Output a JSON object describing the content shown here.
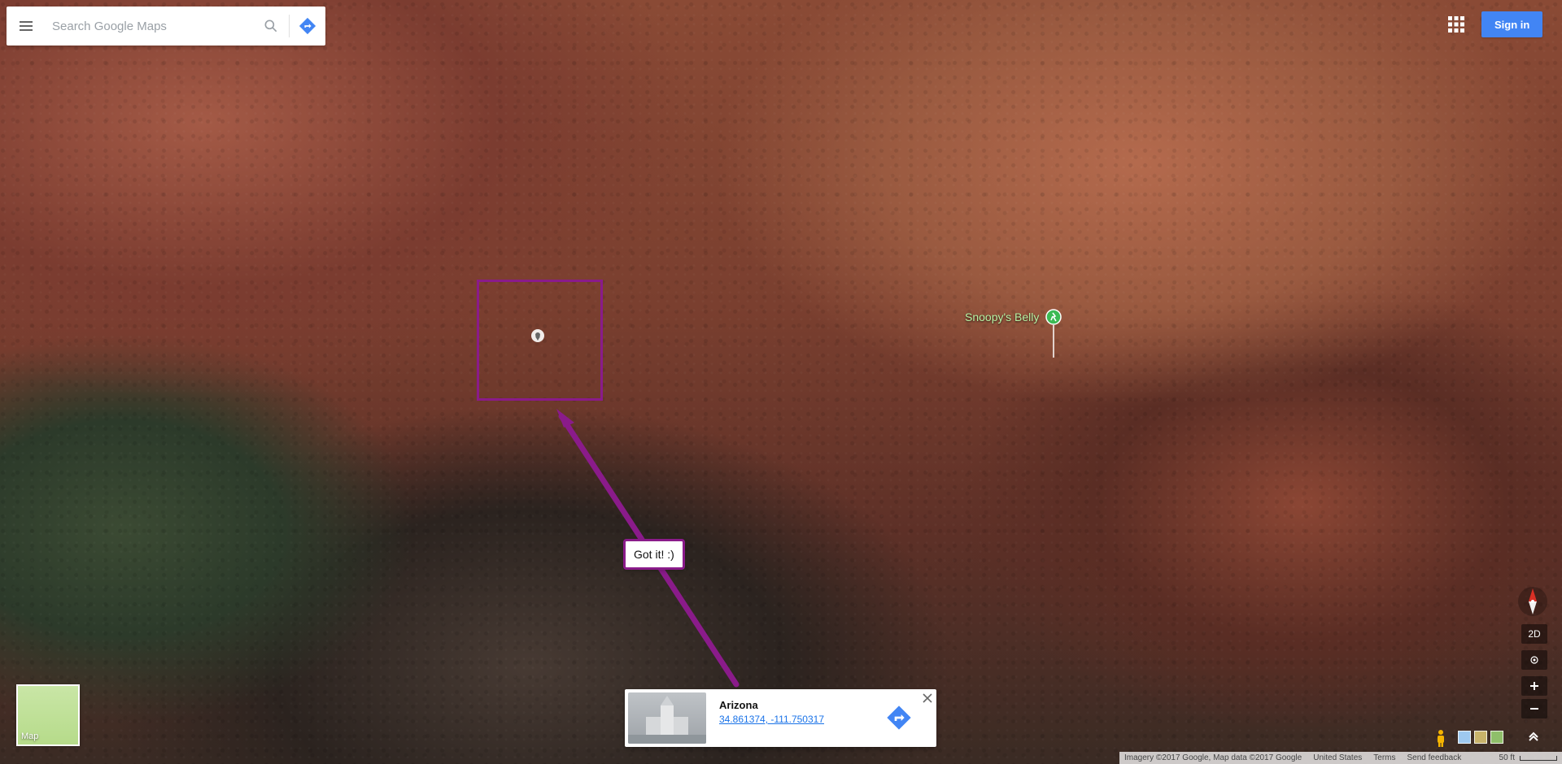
{
  "search": {
    "placeholder": "Search Google Maps"
  },
  "header": {
    "sign_in": "Sign in"
  },
  "annotation": {
    "callout_text": "Got it! :)"
  },
  "place_label": {
    "name": "Snoopy's Belly"
  },
  "info_card": {
    "title": "Arizona",
    "coordinates": "34.861374, -111.750317"
  },
  "map_switcher": {
    "label": "Map"
  },
  "controls": {
    "mode_label": "2D"
  },
  "footer": {
    "attribution": "Imagery ©2017 Google, Map data ©2017 Google",
    "country": "United States",
    "terms": "Terms",
    "feedback": "Send feedback",
    "scale": "50 ft"
  },
  "colors": {
    "annotation": "#8a1b8a",
    "signin": "#4285f4",
    "link": "#1a73e8",
    "place_label": "#b7f2a4"
  }
}
